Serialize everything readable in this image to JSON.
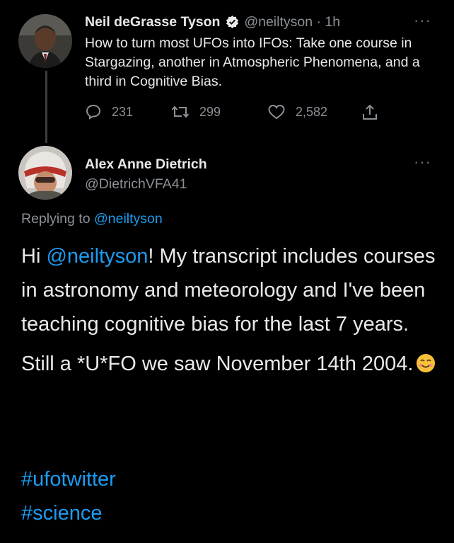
{
  "tweet1": {
    "author_name": "Neil deGrasse Tyson",
    "handle": "@neiltyson",
    "separator": "·",
    "time": "1h",
    "text": "How to turn most UFOs into IFOs: Take one course in Stargazing, another in Atmospheric Phenomena, and a third in Cognitive Bias.",
    "reply_count": "231",
    "retweet_count": "299",
    "like_count": "2,582",
    "verified": true
  },
  "tweet2": {
    "author_name": "Alex Anne Dietrich",
    "handle": "@DietrichVFA41",
    "replying_prefix": "Replying to",
    "replying_to": "@neiltyson",
    "greeting": "Hi",
    "mention": "@neiltyson",
    "text_after_mention": "! My transcript includes courses in astronomy and meteorology and I've been teaching cognitive bias for the last 7 years.",
    "paragraph2": "Still a *U*FO we saw November 14th 2004.",
    "hashtags": [
      "#ufotwitter",
      "#science"
    ]
  },
  "colors": {
    "background": "#000000",
    "text": "#e7e9ea",
    "muted": "#8b9096",
    "link": "#1d9bf0"
  },
  "icons": [
    "verified-badge-icon",
    "reply-icon",
    "retweet-icon",
    "like-icon",
    "share-icon",
    "more-icon",
    "smiling-emoji-icon"
  ]
}
